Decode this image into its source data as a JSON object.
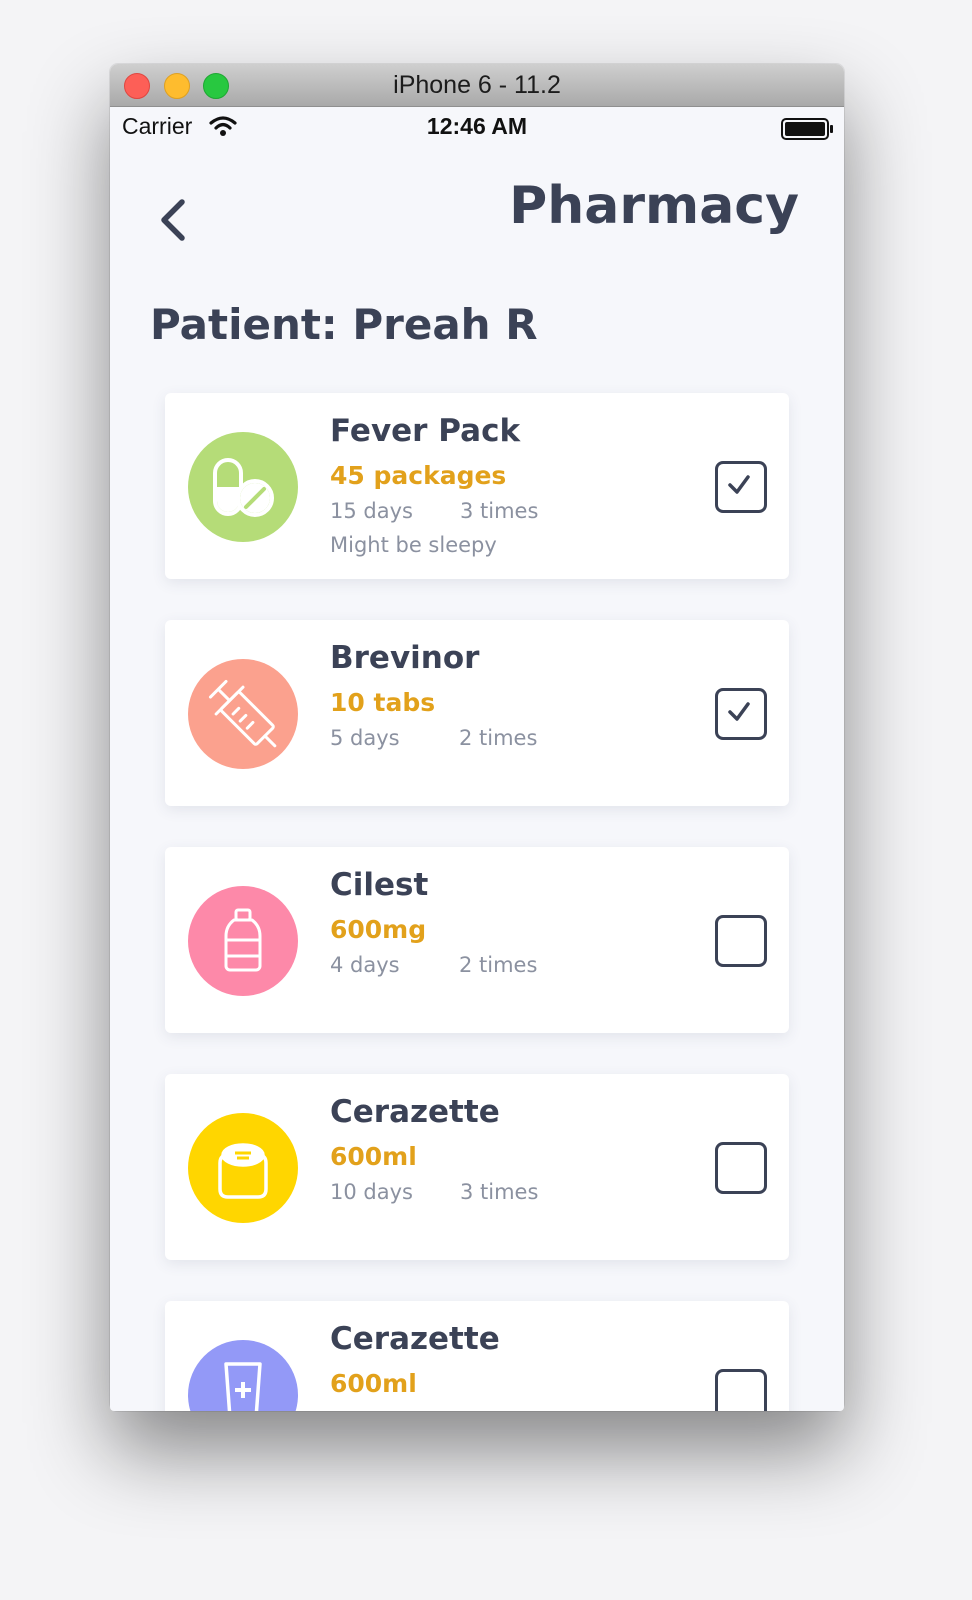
{
  "window": {
    "title": "iPhone 6 - 11.2"
  },
  "status_bar": {
    "carrier": "Carrier",
    "time": "12:46 AM"
  },
  "header": {
    "title": "Pharmacy",
    "back_icon": "chevron-left-icon"
  },
  "patient": {
    "label": "Patient: Preah R"
  },
  "medications": [
    {
      "name": "Fever Pack",
      "quantity": "45 packages",
      "days": "15 days",
      "times": "3 times",
      "note": "Might be sleepy",
      "checked": true,
      "icon": "pill-capsule-icon",
      "icon_color": "#b5dc78"
    },
    {
      "name": "Brevinor",
      "quantity": "10 tabs",
      "days": "5 days",
      "times": "2 times",
      "checked": true,
      "icon": "syringe-icon",
      "icon_color": "#fba18e"
    },
    {
      "name": "Cilest",
      "quantity": "600mg",
      "days": "4 days",
      "times": "2 times",
      "checked": false,
      "icon": "bottle-icon",
      "icon_color": "#fd89a9"
    },
    {
      "name": "Cerazette",
      "quantity": "600ml",
      "days": "10 days",
      "times": "3 times",
      "checked": false,
      "icon": "jar-icon",
      "icon_color": "#ffd600"
    },
    {
      "name": "Cerazette",
      "quantity": "600ml",
      "checked": false,
      "icon": "medical-tube-icon",
      "icon_color": "#9399f7"
    }
  ],
  "colors": {
    "title": "#3b4256",
    "quantity": "#e2a11b",
    "meta": "#8b91a0",
    "background": "#f6f7fb"
  }
}
